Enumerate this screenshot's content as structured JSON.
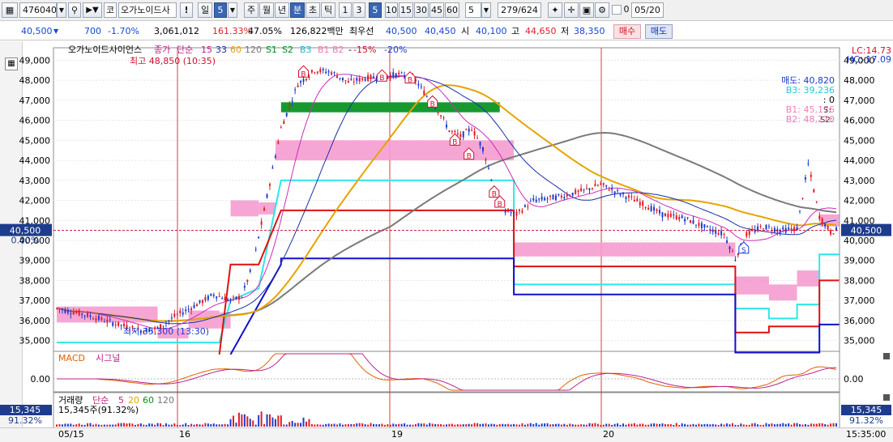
{
  "toolbar": {
    "stock_code": "476040",
    "market_tag": "코",
    "stock_name": "오가노이드사",
    "warn_label": "!",
    "period_day": "일",
    "period_min": "5",
    "period_week": "주",
    "period_month": "월",
    "period_year": "년",
    "period_minute": "분",
    "period_second": "초",
    "period_tick": "틱",
    "intervals": [
      "1",
      "3",
      "5",
      "10",
      "15",
      "30",
      "45",
      "60"
    ],
    "interval_selected": "5",
    "interval_value": "5",
    "count": "279",
    "count_total": "/624",
    "checkbox_label": "0",
    "date": "05/20"
  },
  "pricebar": {
    "price": "40,500",
    "change": "700",
    "change_pct": "-1.70%",
    "volume": "3,061,012",
    "volume_pct": "161.33%",
    "strength": "47.05%",
    "amount": "126,822백만",
    "best_label": "최우선",
    "best_ask": "40,500",
    "best_bid": "40,450",
    "open_label": "시",
    "open": "40,100",
    "high_label": "고",
    "high": "44,650",
    "low_label": "저",
    "low": "38,350",
    "buy_label": "매수",
    "sell_label": "매도"
  },
  "chart_data": {
    "type": "candlestick",
    "legend": {
      "name": "오가노이드사이언스",
      "close_label": "종가",
      "simple_label": "단순",
      "ma": [
        "15",
        "33",
        "60",
        "120"
      ],
      "s1": "S1",
      "s2": "S2",
      "b3": "B3",
      "b1": "B1",
      "b2": "B2",
      "pct_a": "-15%",
      "pct_b": "-20%"
    },
    "colors": {
      "up": "#e01c24",
      "down": "#1a3ccf",
      "ma15": "#cc2eb8",
      "ma33": "#1a2fa8",
      "ma60": "#e6a300",
      "ma120": "#7a7a7a",
      "pink_band": "#f59ccf",
      "green_band": "#17992f",
      "cyan": "#2ee6e6",
      "red_step": "#e01010",
      "blue_step": "#1010cc"
    },
    "y_ticks": [
      "49,000",
      "48,000",
      "47,000",
      "46,000",
      "45,000",
      "44,000",
      "43,000",
      "42,000",
      "41,000",
      "40,000",
      "39,000",
      "38,000",
      "37,000",
      "36,000",
      "35,000"
    ],
    "y_range": [
      34500,
      49300
    ],
    "current_price": "40,500",
    "current_pct": "0.00%",
    "max_label": "최고 48,850 (10:35)",
    "min_label": "최저 35,300 (13:30)",
    "lc_label": "LC:14.73",
    "hc_label": "HC:-17.09",
    "info_sell": "매도: 40,820",
    "info_b3": "B3: 39,236",
    "info_zero": ": 0",
    "info_b1": "B1: 45,176",
    "info_b2": "B2: 48,210",
    "info_s": "S:",
    "info_s2": "S2:",
    "x_labels": [
      "05/15",
      "16",
      "19",
      "20"
    ],
    "macd": {
      "label": "MACD",
      "signal_label": "시그널",
      "zero_tick": "0.00"
    },
    "volume": {
      "label": "거래량",
      "simple_label": "단순",
      "ma": [
        "5",
        "20",
        "60",
        "120"
      ],
      "value_text": "15,345주(91.32%)",
      "right_value": "15,345",
      "right_pct": "91.32%"
    }
  },
  "statusbar": {
    "time": "15:35:00"
  }
}
